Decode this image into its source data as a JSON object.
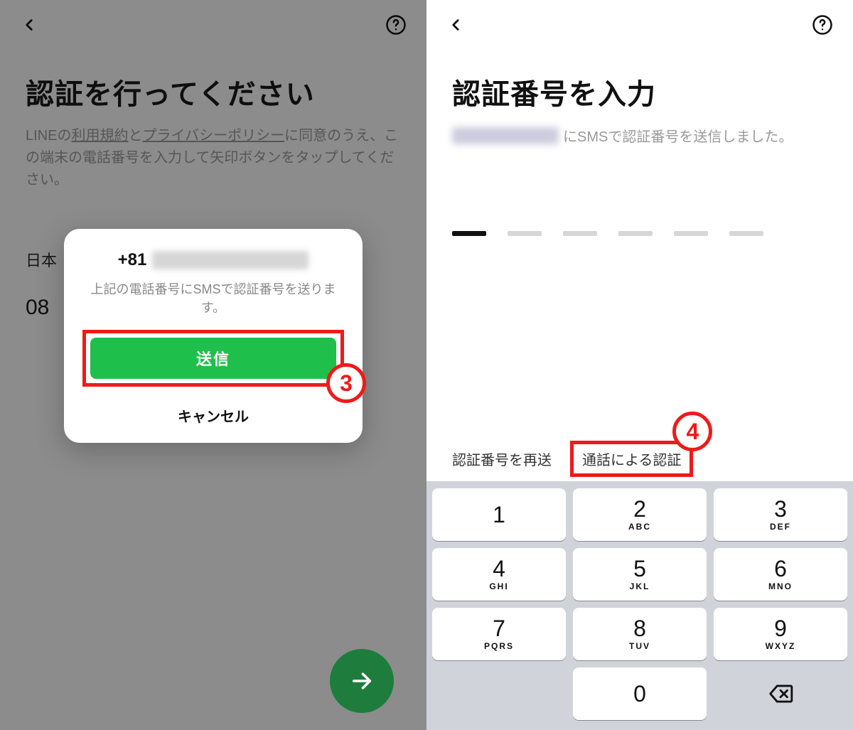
{
  "annotations": {
    "badge_left": "3",
    "badge_right": "4"
  },
  "left": {
    "title": "認証を行ってください",
    "desc_pre": "LINEの",
    "link_tos": "利用規約",
    "desc_and": "と",
    "link_privacy": "プライバシーポリシー",
    "desc_post": "に同意のうえ、この端末の電話番号を入力して矢印ボタンをタップしてください。",
    "country": "日本",
    "phone_prefix": "08",
    "dialog": {
      "prefix": "+81",
      "message": "上記の電話番号にSMSで認証番号を送ります。",
      "send": "送信",
      "cancel": "キャンセル"
    }
  },
  "right": {
    "title": "認証番号を入力",
    "sms_suffix": "にSMSで認証番号を送信しました。",
    "resend": "認証番号を再送",
    "call_auth": "通話による認証",
    "keypad": [
      [
        {
          "d": "1",
          "l": ""
        },
        {
          "d": "2",
          "l": "ABC"
        },
        {
          "d": "3",
          "l": "DEF"
        }
      ],
      [
        {
          "d": "4",
          "l": "GHI"
        },
        {
          "d": "5",
          "l": "JKL"
        },
        {
          "d": "6",
          "l": "MNO"
        }
      ],
      [
        {
          "d": "7",
          "l": "PQRS"
        },
        {
          "d": "8",
          "l": "TUV"
        },
        {
          "d": "9",
          "l": "WXYZ"
        }
      ],
      [
        null,
        {
          "d": "0",
          "l": ""
        },
        "backspace"
      ]
    ]
  }
}
